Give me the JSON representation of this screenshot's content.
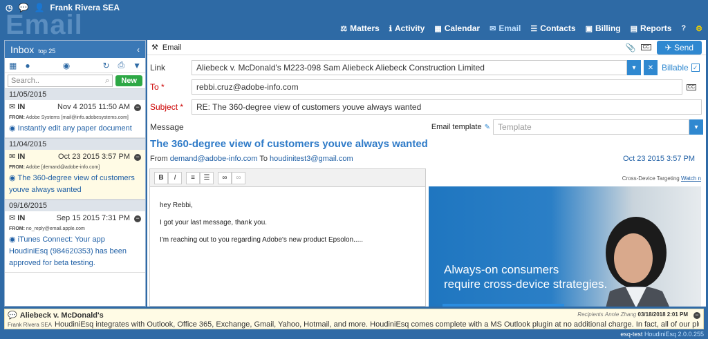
{
  "user": {
    "name": "Frank Rivera SEA"
  },
  "app": {
    "section_title": "Email"
  },
  "nav": [
    {
      "label": "Matters",
      "icon": "gavel-icon",
      "glyph": "⚖"
    },
    {
      "label": "Activity",
      "icon": "info-icon",
      "glyph": "ℹ"
    },
    {
      "label": "Calendar",
      "icon": "calendar-icon",
      "glyph": "▦"
    },
    {
      "label": "Email",
      "icon": "envelope-icon",
      "glyph": "✉",
      "active": true
    },
    {
      "label": "Contacts",
      "icon": "contacts-icon",
      "glyph": "☰"
    },
    {
      "label": "Billing",
      "icon": "billing-icon",
      "glyph": "▣"
    },
    {
      "label": "Reports",
      "icon": "chart-icon",
      "glyph": "▤"
    }
  ],
  "inbox": {
    "title": "Inbox",
    "subtitle": "top 25",
    "search_placeholder": "Search..",
    "new_label": "New",
    "groups": [
      {
        "date": "11/05/2015",
        "messages": [
          {
            "dir": "IN",
            "date": "Nov 4 2015 11:50 AM",
            "from": "Adobe Systems [mail@info.adobesystems.com]",
            "subject": "Instantly edit any paper document",
            "selected": false
          }
        ]
      },
      {
        "date": "11/04/2015",
        "messages": [
          {
            "dir": "IN",
            "date": "Oct 23 2015 3:57 PM",
            "from": "Adobe [demand@adobe-info.com]",
            "subject": "The 360-degree view of customers youve always wanted",
            "selected": true
          }
        ]
      },
      {
        "date": "09/16/2015",
        "messages": [
          {
            "dir": "IN",
            "date": "Sep 15 2015 7:31 PM",
            "from": "no_reply@email.apple.com",
            "subject": "iTunes Connect: Your app HoudiniEsq (984620353) has been approved for beta testing.",
            "selected": false
          }
        ]
      }
    ]
  },
  "compose": {
    "header_label": "Email",
    "send_label": "Send",
    "link_label": "Link",
    "link_value": "Aliebeck v. McDonald's M223-098 Sam Aliebeck Aliebeck Construction Limited",
    "billable_label": "Billable",
    "to_label": "To *",
    "to_value": "rebbi.cruz@adobe-info.com",
    "subject_label": "Subject *",
    "subject_value": "RE: The 360-degree view of customers youve always wanted",
    "message_label": "Message",
    "template_label": "Email template",
    "template_placeholder": "Template"
  },
  "email_view": {
    "subject": "The 360-degree view of customers youve always wanted",
    "from_prefix": "From",
    "from": "demand@adobe-info.com",
    "to_prefix": "To",
    "to": "houdinitest3@gmail.com",
    "date": "Oct 23 2015 3:57 PM",
    "body_lines": [
      "hey Rebbi,",
      "I got your last message, thank you.",
      "I'm reaching out to you regarding Adobe's new product Epsolon....."
    ],
    "ad_header": "Cross-Device Targeting",
    "ad_link": "Watch n",
    "ad_text_1": "Always-on consumers",
    "ad_text_2": "require cross-device strategies."
  },
  "activity": {
    "title": "Aliebeck v. McDonald's",
    "recipients_label": "Recipients",
    "recipients_name": "Annie Zhang",
    "timestamp": "03/18/2018 2:01 PM",
    "author": "Frank Rivera SEA",
    "text": "HoudiniEsq integrates with Outlook, Office 365, Exchange, Gmail, Yahoo, Hotmail, and more. HoudiniEsq comes complete with a MS Outlook plugin at no additional charge. In fact, all of our plugins"
  },
  "footer": {
    "env": "esq-test",
    "version": "HoudiniEsq 2.0.0.255"
  }
}
